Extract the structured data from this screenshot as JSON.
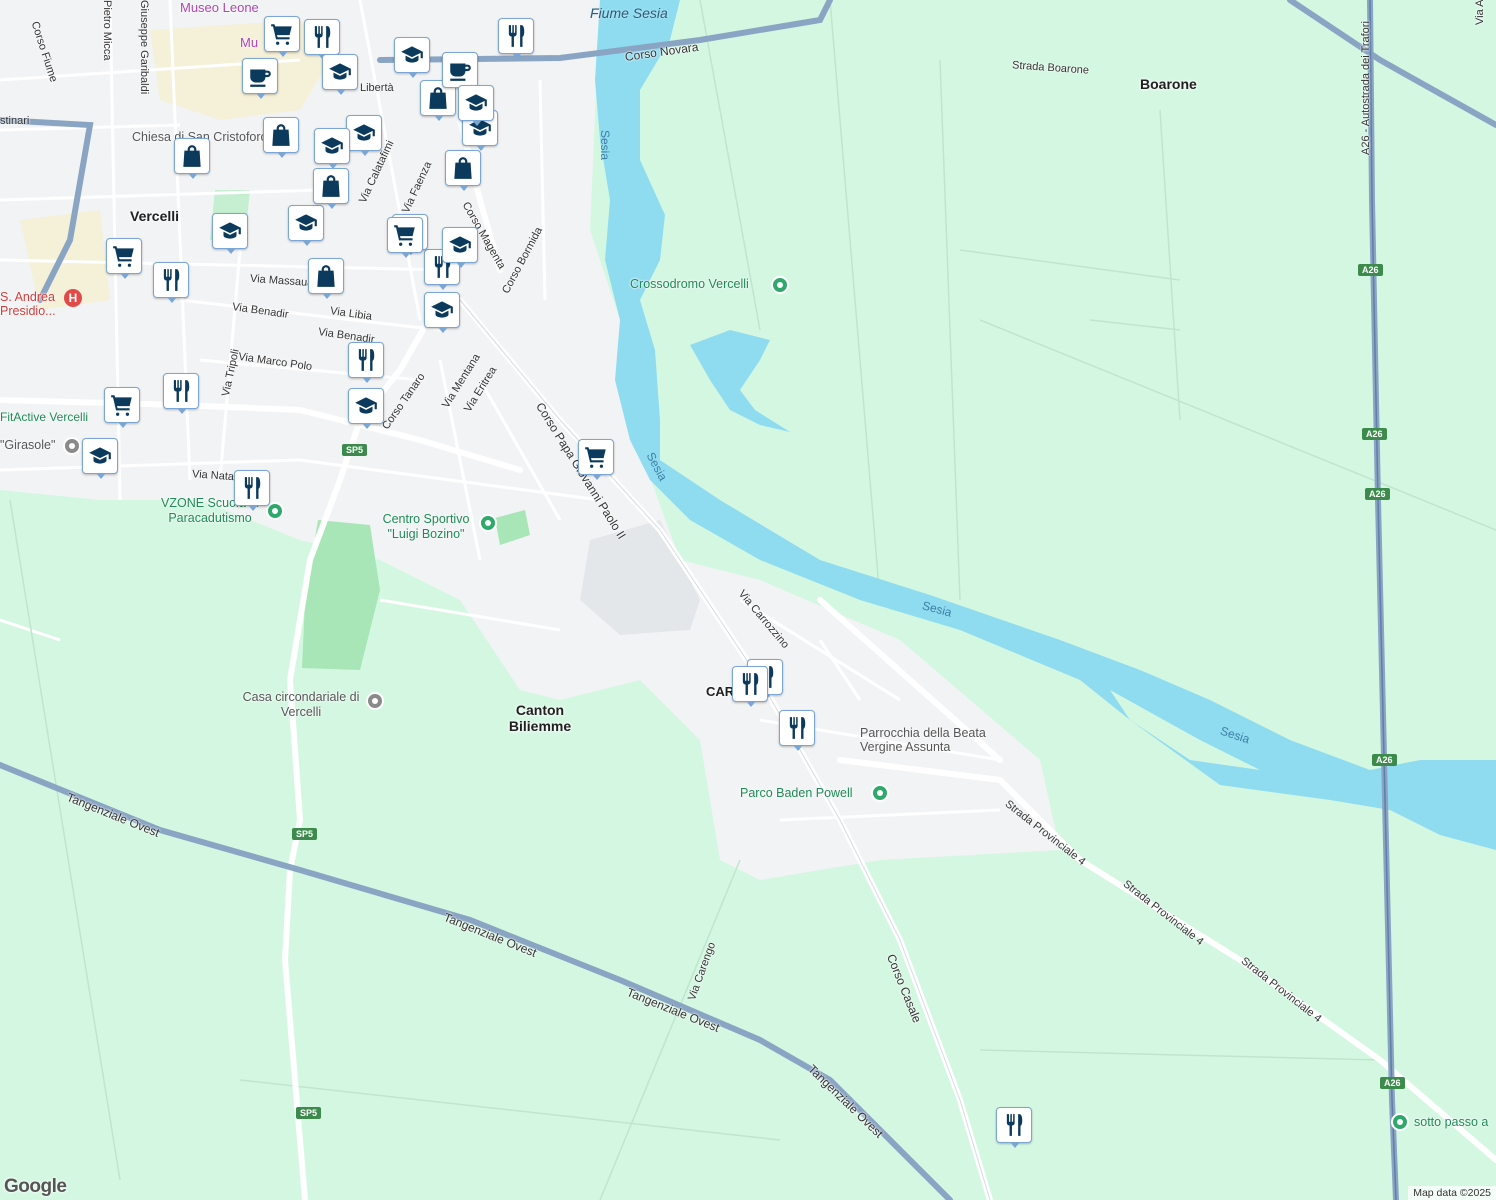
{
  "attribution": "Map data ©2025",
  "logo_text": "Google",
  "colors": {
    "land": "#d4f7e2",
    "urban": "#f2f3f5",
    "water": "#8fdcf0",
    "road": "#ffffff",
    "highway": "#8aa4c4",
    "pin_icon": "#0c3a5c"
  },
  "labels": {
    "river_title": "Fiume Sesia",
    "corso_novara": "Corso Novara",
    "strada_boarone": "Strada Boarone",
    "boarone": "Boarone",
    "sesia_1": "Sesia",
    "sesia_2": "Sesia",
    "sesia_3": "Sesia",
    "sesia_4": "Sesia",
    "museo": "Museo Leone",
    "mu": "Mu",
    "corso_fiume": "Corso Fiume",
    "garibaldi": "Giuseppe Garibaldi",
    "micca": "Pietro Micca",
    "libertà": "Libertà",
    "cristinari": "stinari",
    "chiesa": "Chiesa di San Cristoforo",
    "vercelli": "Vercelli",
    "calatafimi": "Via Calatafimi",
    "faenza": "Via Faenza",
    "magenta": "Corso Magenta",
    "bormida": "Corso Bormida",
    "massaua": "Via Massaua",
    "libia": "Via Libia",
    "benadir": "Via Benadir",
    "benadir2": "Via Benadir",
    "marco_polo": "Via Marco Polo",
    "tripoli": "Via Tripoli",
    "tanaro": "Corso Tanaro",
    "mentana": "Via Mentana",
    "eritrea": "Via Eritrea",
    "giovanni_paolo": "Corso Papa Giovanni Paolo II",
    "hospital": "S. Andrea Presidio...",
    "fitactive": "FitActive Vercelli",
    "girasole": "\"Girasole\"",
    "natale": "Via Natale",
    "vzone": "VZONE Scuola di Paracadutismo",
    "centro_sportivo": "Centro Sportivo \"Luigi Bozino\"",
    "crossodromo": "Crossodromo Vercelli",
    "carrozzino": "Via Carrozzino",
    "casa_circ": "Casa circondariale di Vercelli",
    "canton": "Canton Biliemme",
    "car": "CAR",
    "parrocchia": "Parrocchia della Beata Vergine Assunta",
    "parco": "Parco Baden Powell",
    "sp4_1": "Strada Provinciale 4",
    "sp4_2": "Strada Provinciale 4",
    "sp4_3": "Strada Provinciale 4",
    "tangenziale_1": "Tangenziale Ovest",
    "tangenziale_2": "Tangenziale Ovest",
    "tangenziale_3": "Tangenziale Ovest",
    "tangenziale_4": "Tangenziale Ovest",
    "carengo": "Via Carengo",
    "corso_casale": "Corso Casale",
    "a26": "A26 - Autostrada dei Trafori",
    "sotto_passo": "sotto passo a",
    "via_af": "Via A. F. Vietti"
  },
  "shields": {
    "sp5_a": "SP5",
    "sp5_b": "SP5",
    "sp5_c": "SP5",
    "a26_a": "A26",
    "a26_b": "A26",
    "a26_c": "A26",
    "a26_d": "A26",
    "a26_e": "A26"
  },
  "markers": [
    {
      "type": "restaurant"
    },
    {
      "type": "cafe"
    },
    {
      "type": "school"
    },
    {
      "type": "shopping"
    },
    {
      "type": "supermarket"
    },
    {
      "type": "school"
    },
    {
      "type": "restaurant"
    },
    {
      "type": "shopping"
    },
    {
      "type": "school"
    },
    {
      "type": "shopping"
    },
    {
      "type": "school"
    },
    {
      "type": "shopping"
    },
    {
      "type": "school"
    },
    {
      "type": "supermarket"
    },
    {
      "type": "restaurant"
    },
    {
      "type": "school"
    },
    {
      "type": "shopping"
    },
    {
      "type": "school"
    },
    {
      "type": "restaurant"
    },
    {
      "type": "restaurant"
    },
    {
      "type": "school"
    },
    {
      "type": "supermarket"
    },
    {
      "type": "school"
    },
    {
      "type": "supermarket"
    },
    {
      "type": "restaurant"
    },
    {
      "type": "restaurant"
    },
    {
      "type": "school"
    },
    {
      "type": "restaurant"
    },
    {
      "type": "school"
    },
    {
      "type": "restaurant"
    },
    {
      "type": "restaurant"
    },
    {
      "type": "restaurant"
    },
    {
      "type": "cafe"
    },
    {
      "type": "school"
    },
    {
      "type": "shopping"
    },
    {
      "type": "supermarket"
    },
    {
      "type": "restaurant"
    }
  ]
}
